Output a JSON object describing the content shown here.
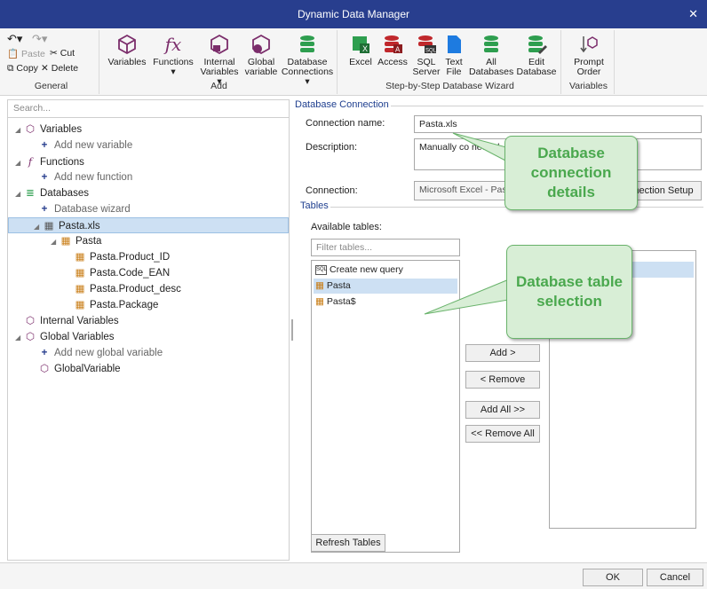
{
  "window": {
    "title": "Dynamic Data Manager",
    "close": "✕"
  },
  "ribbon": {
    "general": {
      "label": "General",
      "paste": "Paste",
      "cut": "Cut",
      "copy": "Copy",
      "delete": "Delete"
    },
    "add": {
      "label": "Add",
      "variables": "Variables",
      "functions": "Functions",
      "internal": "Internal Variables ▾",
      "global": "Global variable",
      "dbconn": "Database Connections ▾"
    },
    "wizard": {
      "label": "Step-by-Step Database Wizard",
      "excel": "Excel",
      "access": "Access",
      "sql": "SQL Server",
      "text": "Text File",
      "all": "All Databases",
      "edit": "Edit Database"
    },
    "variables": {
      "label": "Variables",
      "prompt": "Prompt Order"
    }
  },
  "search": {
    "placeholder": "Search..."
  },
  "tree": {
    "variables": "Variables",
    "add_variable": "Add new variable",
    "functions": "Functions",
    "add_function": "Add new function",
    "databases": "Databases",
    "db_wizard": "Database wizard",
    "pasta_xls": "Pasta.xls",
    "pasta": "Pasta",
    "fields": [
      "Pasta.Product_ID",
      "Pasta.Code_EAN",
      "Pasta.Product_desc",
      "Pasta.Package"
    ],
    "internal": "Internal Variables",
    "global": "Global Variables",
    "add_global": "Add new global variable",
    "global_var": "GlobalVariable"
  },
  "connection": {
    "section": "Database Connection",
    "name_label": "Connection name:",
    "name_value": "Pasta.xls",
    "desc_label": "Description:",
    "desc_value": "Manually co  nected",
    "conn_label": "Connection:",
    "conn_value": "Microsoft Excel - Pas",
    "setup_button": "nection Setup"
  },
  "tables": {
    "section": "Tables",
    "available_label": "Available tables:",
    "filter_placeholder": "Filter tables...",
    "items": [
      "Create new query",
      "Pasta",
      "Pasta$"
    ],
    "add": "Add >",
    "remove": "< Remove",
    "add_all": "Add All >>",
    "remove_all": "<< Remove All",
    "refresh": "Refresh Tables"
  },
  "callouts": {
    "connection": "Database connection details",
    "tables": "Database table selection"
  },
  "footer": {
    "ok": "OK",
    "cancel": "Cancel"
  },
  "colors": {
    "titlebar": "#283e8e",
    "callout_fill": "#d8eed6",
    "callout_text": "#4aa84e",
    "selection": "#cde0f3"
  }
}
